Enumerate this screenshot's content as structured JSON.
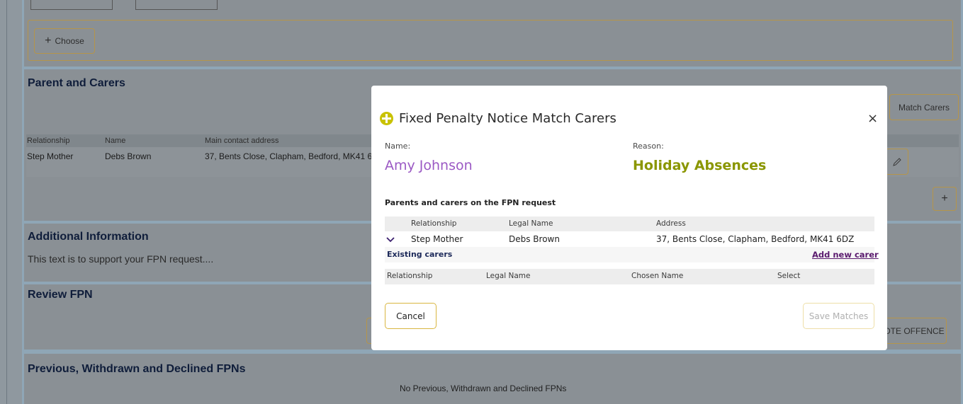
{
  "background": {
    "choose_button": "Choose",
    "plus_glyph": "+",
    "parent_section_title": "Parent and Carers",
    "match_carers_button": "Match Carers",
    "carer_table": {
      "headers": [
        "Relationship",
        "Name",
        "Main contact address"
      ],
      "row": [
        "Step Mother",
        "Debs Brown",
        "37, Bents Close, Clapham, Bedford, MK41 6I"
      ]
    },
    "additional_info_title": "Additional Information",
    "additional_info_text": "This text is to support your FPN request....",
    "review_title": "Review FPN",
    "note_offence_button": "OTE OFFENCE",
    "previous_title": "Previous, Withdrawn and Declined FPNs",
    "previous_empty": "No Previous, Withdrawn and Declined FPNs"
  },
  "modal": {
    "title": "Fixed Penalty Notice Match Carers",
    "close_glyph": "×",
    "name_label": "Name:",
    "name_value": "Amy Johnson",
    "reason_label": "Reason:",
    "reason_value": "Holiday Absences",
    "section_heading": "Parents and carers on the FPN request",
    "request_table": {
      "headers": [
        "Relationship",
        "Legal Name",
        "Address"
      ],
      "row": [
        "Step Mother",
        "Debs Brown",
        "37, Bents Close, Clapham, Bedford, MK41 6DZ"
      ]
    },
    "existing_carers_label": "Existing carers",
    "add_new_carer_link": "Add new carer",
    "existing_table_headers": [
      "Relationship",
      "Legal Name",
      "Chosen Name",
      "Select"
    ],
    "cancel_button": "Cancel",
    "save_button": "Save Matches"
  },
  "colors": {
    "accent_gold": "#d9b640",
    "name_purple": "#9b59c4",
    "reason_olive": "#8a9600",
    "link_purple": "#5a1a6e"
  }
}
